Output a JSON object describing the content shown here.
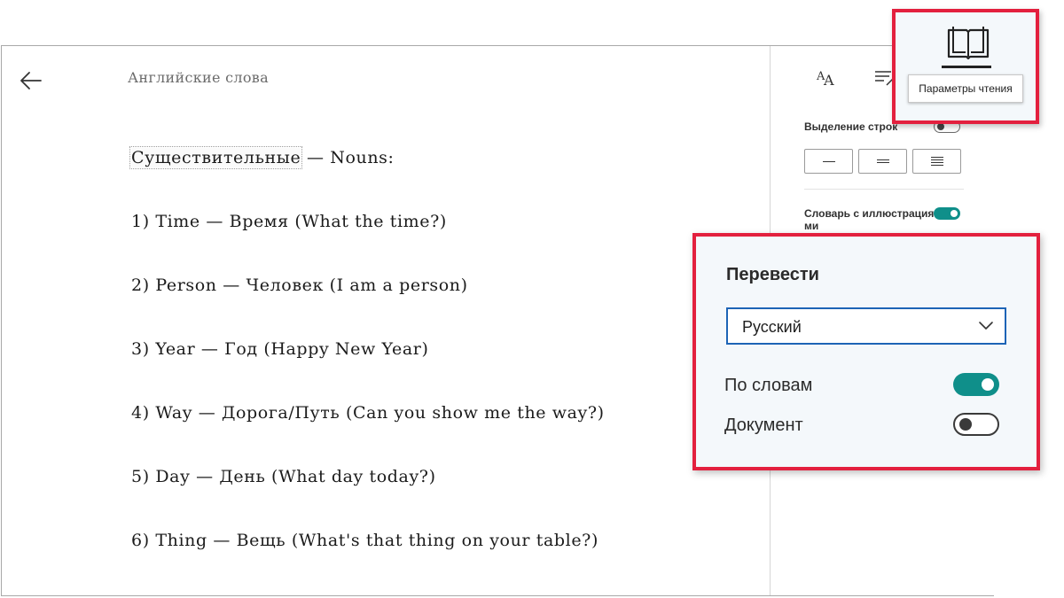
{
  "document": {
    "title": "Английские слова",
    "heading": {
      "highlighted": "Существительные",
      "rest": " — Nouns:"
    },
    "lines": [
      "1) Time — Время (What the time?)",
      "2) Person — Человек (I am a person)",
      "3) Year — Год (Happy New Year)",
      "4) Way — Дорога/Путь (Can you show me the way?)",
      "5) Day — День (What day today?)",
      "6) Thing — Вещь (What's that thing on your table?)"
    ]
  },
  "side_panel": {
    "line_focus_label": "Выделение строк",
    "line_focus_on": false,
    "picture_dictionary_label": "Словарь с иллюстрациями",
    "picture_dictionary_on": true
  },
  "reading_preferences": {
    "tooltip": "Параметры чтения"
  },
  "translate": {
    "title": "Перевести",
    "language": "Русский",
    "by_words_label": "По словам",
    "by_words_on": true,
    "document_label": "Документ",
    "document_on": false
  },
  "colors": {
    "accent": "#0f8f8a",
    "callout_border": "#e3203e",
    "select_border": "#1d64b6"
  }
}
